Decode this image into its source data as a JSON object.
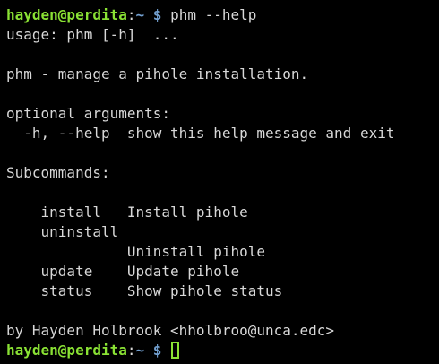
{
  "terminal": {
    "prompt": {
      "user_host": "hayden@perdita",
      "colon": ":",
      "path": "~",
      "dollar": "$"
    },
    "command": "phm --help",
    "output": [
      "usage: phm [-h]  ...",
      "",
      "phm - manage a pihole installation.",
      "",
      "optional arguments:",
      "  -h, --help  show this help message and exit",
      "",
      "Subcommands:",
      "",
      "    install   Install pihole",
      "    uninstall",
      "              Uninstall pihole",
      "    update    Update pihole",
      "    status    Show pihole status",
      "",
      "by Hayden Holbrook <hholbroo@unca.edc>"
    ]
  },
  "colors": {
    "background": "#000000",
    "text": "#d8d8d8",
    "user_host": "#8ae234",
    "path": "#729fcf",
    "cursor": "#8ae234"
  }
}
